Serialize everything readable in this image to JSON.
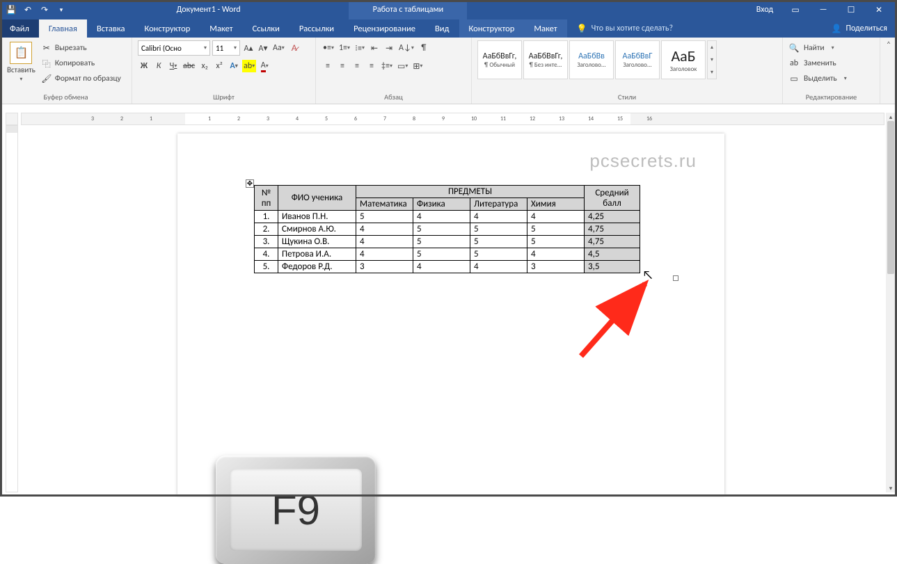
{
  "titlebar": {
    "title": "Документ1 - Word",
    "context": "Работа с таблицами",
    "login": "Вход"
  },
  "tabs": {
    "file": "Файл",
    "items": [
      "Главная",
      "Вставка",
      "Конструктор",
      "Макет",
      "Ссылки",
      "Рассылки",
      "Рецензирование",
      "Вид"
    ],
    "context": [
      "Конструктор",
      "Макет"
    ],
    "tell": "Что вы хотите сделать?",
    "share": "Поделиться"
  },
  "ribbon": {
    "clipboard": {
      "paste": "Вставить",
      "cut": "Вырезать",
      "copy": "Копировать",
      "painter": "Формат по образцу",
      "label": "Буфер обмена"
    },
    "font": {
      "name": "Calibri (Осно",
      "size": "11",
      "label": "Шрифт",
      "bold": "Ж",
      "italic": "К",
      "underline": "Ч",
      "strike": "abc",
      "sub": "x₂",
      "sup": "x²"
    },
    "para": {
      "label": "Абзац"
    },
    "styles": {
      "label": "Стили",
      "items": [
        {
          "preview": "АаБбВвГг,",
          "name": "¶ Обычный"
        },
        {
          "preview": "АаБбВвГг,",
          "name": "¶ Без инте..."
        },
        {
          "preview": "АаБбВв",
          "name": "Заголово...",
          "blue": true
        },
        {
          "preview": "АаБбВвГ",
          "name": "Заголово...",
          "blue": true
        },
        {
          "preview": "АаБ",
          "name": "Заголовок",
          "big": true
        }
      ]
    },
    "editing": {
      "find": "Найти",
      "replace": "Заменить",
      "select": "Выделить",
      "label": "Редактирование"
    }
  },
  "ruler": {
    "hticks": [
      "3",
      "2",
      "1",
      "",
      "1",
      "2",
      "3",
      "4",
      "5",
      "6",
      "7",
      "8",
      "9",
      "10",
      "11",
      "12",
      "13",
      "14",
      "15",
      "16"
    ]
  },
  "watermark": "pcsecrets.ru",
  "table": {
    "headers": {
      "num": "№ пп",
      "fio": "ФИО ученика",
      "subjects": "ПРЕДМЕТЫ",
      "avg": "Средний балл",
      "cols": [
        "Математика",
        "Физика",
        "Литература",
        "Химия"
      ]
    },
    "rows": [
      {
        "n": "1.",
        "fio": "Иванов П.Н.",
        "v": [
          "5",
          "4",
          "4",
          "4"
        ],
        "avg": "4,25"
      },
      {
        "n": "2.",
        "fio": "Смирнов А.Ю.",
        "v": [
          "4",
          "5",
          "5",
          "5"
        ],
        "avg": "4,75"
      },
      {
        "n": "3.",
        "fio": "Щукина О.В.",
        "v": [
          "4",
          "5",
          "5",
          "5"
        ],
        "avg": "4,75"
      },
      {
        "n": "4.",
        "fio": "Петрова И.А.",
        "v": [
          "4",
          "5",
          "5",
          "4"
        ],
        "avg": "4,5"
      },
      {
        "n": "5.",
        "fio": "Федоров Р.Д.",
        "v": [
          "3",
          "4",
          "4",
          "3"
        ],
        "avg": "3,5"
      }
    ]
  },
  "key": "F9"
}
